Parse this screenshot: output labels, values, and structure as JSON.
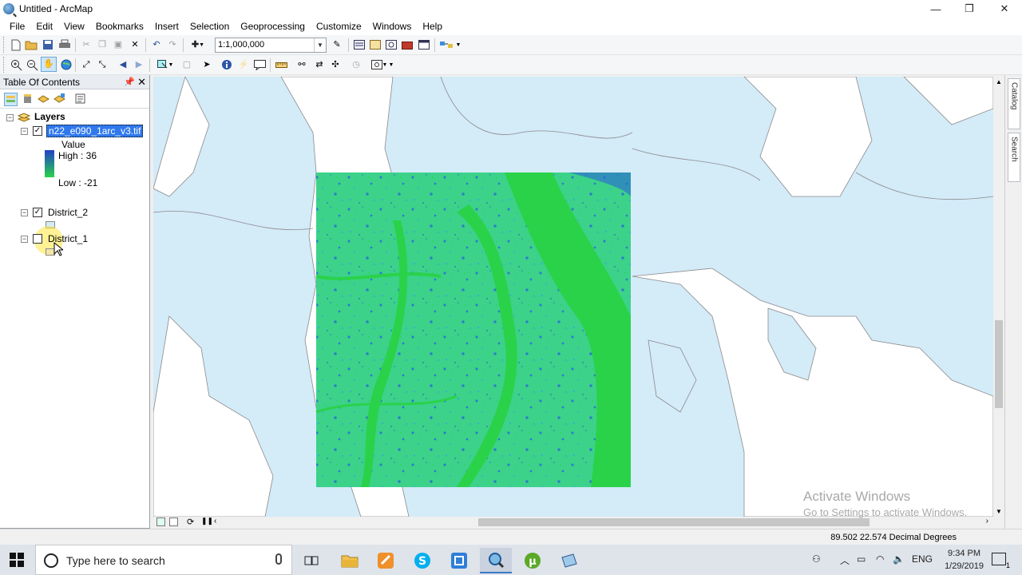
{
  "window": {
    "title": "Untitled - ArcMap",
    "minimize": "—",
    "maximize": "❐",
    "close": "✕"
  },
  "menu": [
    "File",
    "Edit",
    "View",
    "Bookmarks",
    "Insert",
    "Selection",
    "Geoprocessing",
    "Customize",
    "Windows",
    "Help"
  ],
  "toolbar": {
    "scale": "1:1,000,000"
  },
  "toc": {
    "title": "Table Of Contents",
    "root": "Layers",
    "layers": [
      {
        "name": "n22_e090_1arc_v3.tif",
        "checked": true,
        "legend": {
          "heading": "Value",
          "high": "High : 36",
          "low": "Low : -21"
        }
      },
      {
        "name": "District_2",
        "checked": true
      },
      {
        "name": "District_1",
        "checked": false
      }
    ]
  },
  "dock": {
    "catalog": "Catalog",
    "search": "Search"
  },
  "status": {
    "coords": "89.502  22.574 Decimal Degrees"
  },
  "watermark": {
    "line1": "Activate Windows",
    "line2": "Go to Settings to activate Windows."
  },
  "taskbar": {
    "search_placeholder": "Type here to search",
    "language": "ENG",
    "time": "9:34 PM",
    "date": "1/29/2019",
    "notifications": "1"
  },
  "colors": {
    "water": "#d4ebf8",
    "raster_low": "#2ad24a",
    "raster_high": "#2140c8",
    "accent": "#3c78c8"
  }
}
